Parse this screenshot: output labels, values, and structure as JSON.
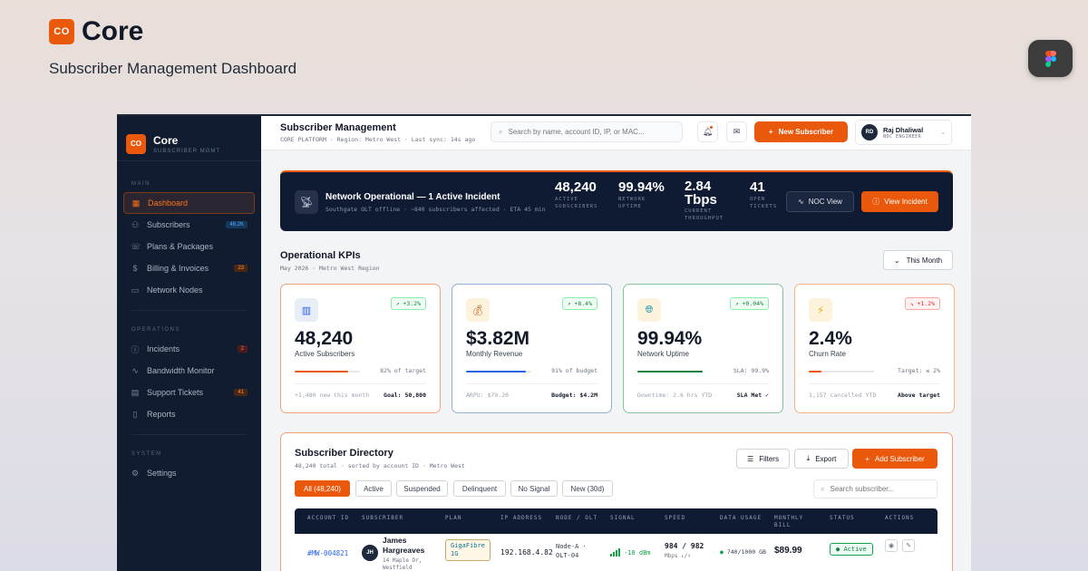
{
  "brand": {
    "badge": "CO",
    "name": "Core",
    "subtitle": "Subscriber Management Dashboard"
  },
  "figma": {
    "icon": "figma-icon"
  },
  "sidebar": {
    "badge": "CO",
    "title": "Core",
    "subtitle": "SUBSCRIBER MGMT",
    "sections": [
      {
        "label": "MAIN",
        "items": [
          {
            "label": "Dashboard",
            "icon": "grid-icon",
            "active": true
          },
          {
            "label": "Subscribers",
            "icon": "users-icon",
            "count": "48.2K",
            "count_style": "blue"
          },
          {
            "label": "Plans & Packages",
            "icon": "phone-icon"
          },
          {
            "label": "Billing & Invoices",
            "icon": "dollar-icon",
            "count": "23",
            "count_style": "orange"
          },
          {
            "label": "Network Nodes",
            "icon": "node-icon"
          }
        ]
      },
      {
        "label": "OPERATIONS",
        "items": [
          {
            "label": "Incidents",
            "icon": "alert-icon",
            "count": "2",
            "count_style": "red"
          },
          {
            "label": "Bandwidth Monitor",
            "icon": "pulse-icon"
          },
          {
            "label": "Support Tickets",
            "icon": "ticket-icon",
            "count": "41",
            "count_style": "orange"
          },
          {
            "label": "Reports",
            "icon": "report-icon"
          }
        ]
      },
      {
        "label": "SYSTEM",
        "items": [
          {
            "label": "Settings",
            "icon": "gear-icon"
          }
        ]
      }
    ]
  },
  "topbar": {
    "title": "Subscriber Management",
    "meta": "CORE PLATFORM · Region: Metro West · Last sync: 14s ago",
    "search_placeholder": "Search by name, account ID, IP, or MAC...",
    "new_label": "New Subscriber",
    "user_initials": "RD",
    "user_name": "Raj Dhaliwal",
    "user_role": "NOC ENGINEER"
  },
  "banner": {
    "title": "Network Operational — 1 Active Incident",
    "subtitle": "Southgate OLT offline · ~840 subscribers affected · ETA 45 min",
    "stats": [
      {
        "value": "48,240",
        "label": "ACTIVE\nSUBSCRIBERS"
      },
      {
        "value": "99.94%",
        "label": "NETWORK\nUPTIME"
      },
      {
        "value": "2.84 Tbps",
        "label": "CURRENT\nTHROUGHPUT"
      },
      {
        "value": "41",
        "label": "OPEN\nTICKETS"
      }
    ],
    "noc_label": "NOC View",
    "incident_label": "View Incident"
  },
  "kpis": {
    "title": "Operational KPIs",
    "subtitle": "May 2026 · Metro West Region",
    "period": "This Month",
    "cards": [
      {
        "icon": "chart-icon",
        "delta": "↗ +3.2%",
        "value": "48,240",
        "label": "Active Subscribers",
        "progress": 0.82,
        "bar_note": "82% of target",
        "foot_left": "+1,480 new this month",
        "foot_right": "Goal: 50,800",
        "accent": "#ea580c",
        "delta_tone": "green"
      },
      {
        "icon": "money-bag-icon",
        "delta": "↗ +8.4%",
        "value": "$3.82M",
        "label": "Monthly Revenue",
        "progress": 0.91,
        "bar_note": "91% of budget",
        "foot_left": "ARPU: $79.20",
        "foot_right": "Budget: $4.2M",
        "accent": "#2563eb",
        "delta_tone": "green"
      },
      {
        "icon": "globe-icon",
        "delta": "↗ +0.04%",
        "value": "99.94%",
        "label": "Network Uptime",
        "progress": 0.9994,
        "bar_note": "SLA: 99.9%",
        "foot_left": "Downtime: 2.6 hrs YTD",
        "foot_right": "SLA Met ✓",
        "accent": "#15803d",
        "delta_tone": "green"
      },
      {
        "icon": "bolt-icon",
        "delta": "↘ +1.2%",
        "value": "2.4%",
        "label": "Churn Rate",
        "progress": 0.2,
        "bar_note": "Target: ≤ 2%",
        "foot_left": "1,157 cancelled YTD",
        "foot_right": "Above target",
        "accent": "#ea580c",
        "delta_tone": "red"
      }
    ]
  },
  "directory": {
    "title": "Subscriber Directory",
    "subtitle": "48,240 total · sorted by account ID · Metro West",
    "filters_label": "Filters",
    "export_label": "Export",
    "add_label": "Add Subscriber",
    "search_placeholder": "Search subscriber...",
    "chips": [
      "All (48,240)",
      "Active",
      "Suspended",
      "Delinquent",
      "No Signal",
      "New (30d)"
    ],
    "columns": [
      "ACCOUNT ID",
      "SUBSCRIBER",
      "PLAN",
      "IP ADDRESS",
      "NODE / OLT",
      "SIGNAL",
      "SPEED",
      "DATA USAGE",
      "MONTHLY\nBILL",
      "STATUS",
      "ACTIONS"
    ],
    "row": {
      "account_id": "#MW-004821",
      "initials": "JH",
      "name": "James\nHargreaves",
      "address": "14 Maple Dr,\nWestfield",
      "plan": "GigaFibre\n1G",
      "ip": "192.168.4.82",
      "node": "Node-A ·\nOLT-04",
      "signal": "-18 dBm",
      "speed": "984 / 982",
      "speed_unit": "Mbps ↓/↑",
      "usage": "740/1000 GB",
      "bill": "$89.99",
      "status": "Active"
    }
  }
}
